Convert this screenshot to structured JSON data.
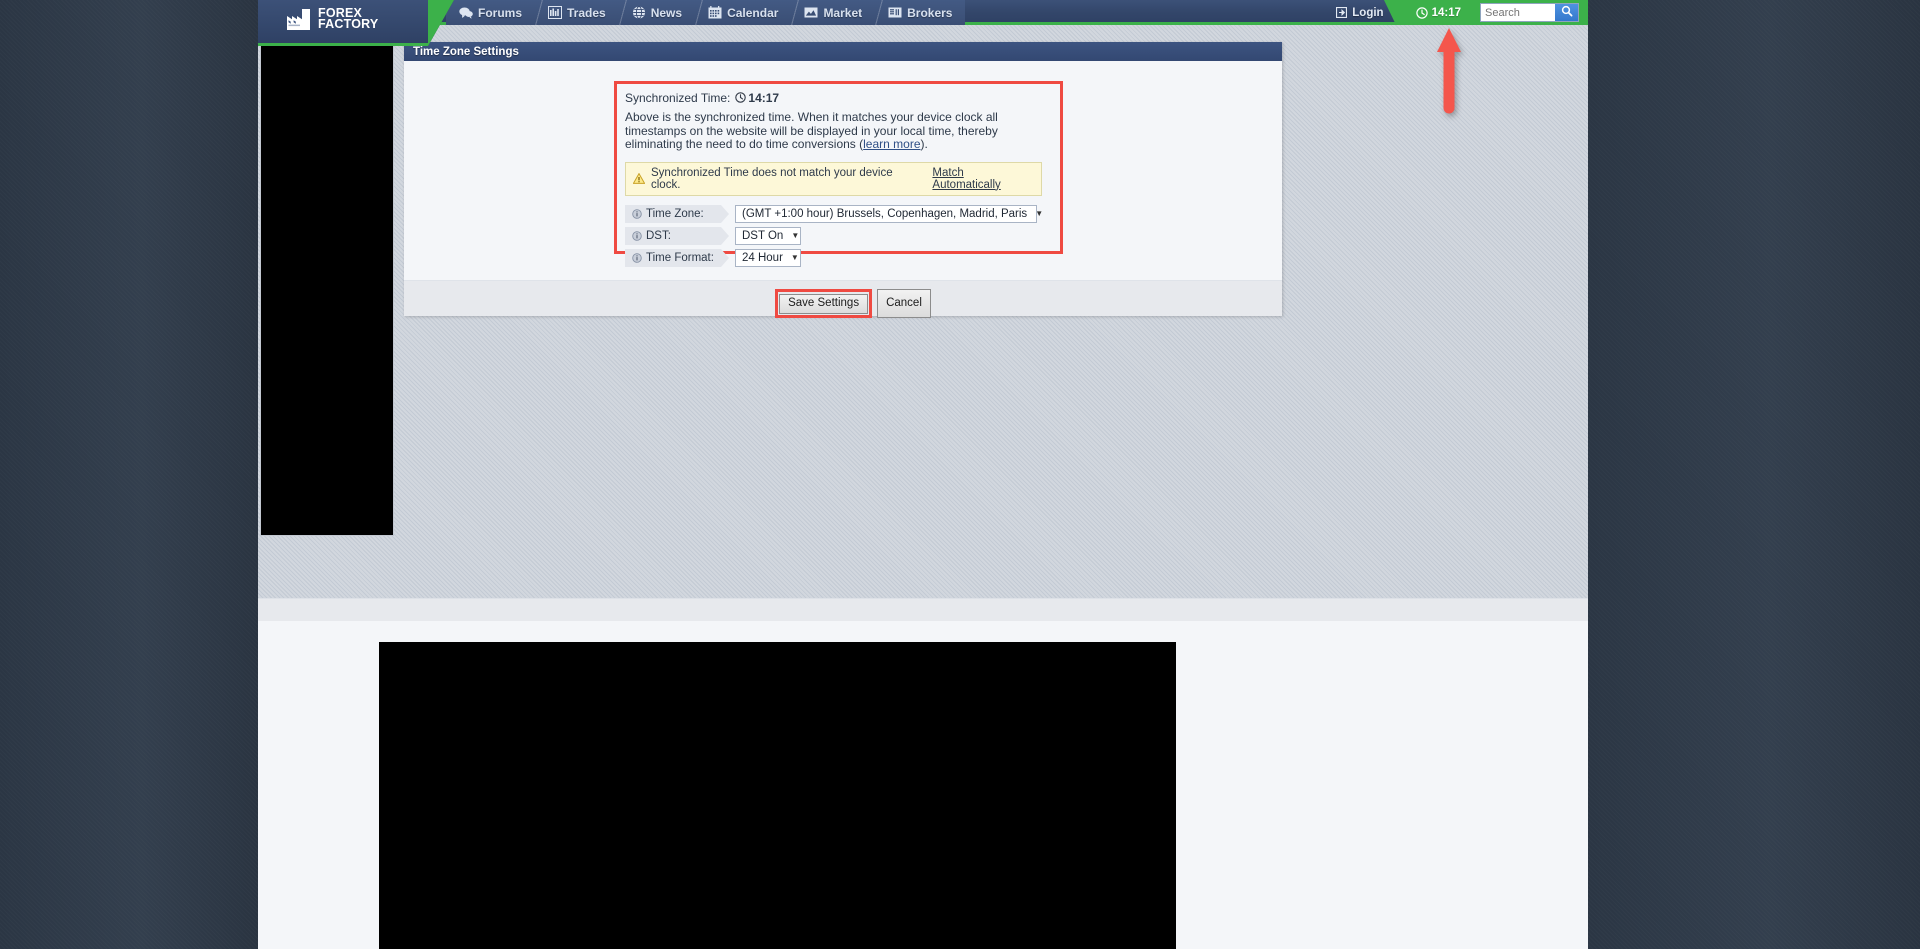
{
  "site": {
    "brand": {
      "line1": "FOREX",
      "line2": "FACTORY",
      "logo_icon": "factory-icon"
    },
    "nav": {
      "items": [
        {
          "label": "Forums",
          "icon": "speech-bubbles-icon"
        },
        {
          "label": "Trades",
          "icon": "bar-chart-icon"
        },
        {
          "label": "News",
          "icon": "globe-icon"
        },
        {
          "label": "Calendar",
          "icon": "calendar-icon"
        },
        {
          "label": "Market",
          "icon": "mountain-chart-icon"
        },
        {
          "label": "Brokers",
          "icon": "building-icon"
        }
      ],
      "login_label": "Login",
      "login_icon": "login-arrow-icon",
      "clock_time": "14:17",
      "clock_icon": "clock-icon",
      "search": {
        "placeholder": "Search",
        "value": "",
        "button_icon": "search-icon"
      }
    }
  },
  "panel": {
    "title": "Time Zone Settings",
    "sync": {
      "label": "Synchronized Time:",
      "icon": "clock-icon",
      "time": "14:17"
    },
    "description_part1": "Above is the synchronized time. When it matches your device clock all timestamps on the website will be displayed in your local time, thereby eliminating the need to do time conversions (",
    "description_link": "learn more",
    "description_part2": ").",
    "warning": {
      "icon": "warning-triangle-icon",
      "text": "Synchronized Time does not match your device clock.",
      "link": "Match Automatically"
    },
    "fields": [
      {
        "label": "Time Zone:",
        "icon": "info-icon",
        "value": "(GMT +1:00 hour) Brussels, Copenhagen, Madrid, Paris",
        "caret": "▼"
      },
      {
        "label": "DST:",
        "icon": "info-icon",
        "value": "DST On",
        "caret": "▼"
      },
      {
        "label": "Time Format:",
        "icon": "info-icon",
        "value": "24 Hour",
        "caret": "▼"
      }
    ],
    "buttons": {
      "save": "Save Settings",
      "cancel": "Cancel"
    }
  },
  "annotations": {
    "arrow": {
      "icon": "up-arrow-annotation",
      "color": "#f4564c"
    },
    "highlight_color": "#ef4a42"
  },
  "colors": {
    "nav_blue": "#35496f",
    "accent_green": "#3cb14a",
    "panel_title_blue": "#3d5481",
    "warning_bg": "#fdf8d8",
    "page_bg": "#2e3b4a"
  }
}
